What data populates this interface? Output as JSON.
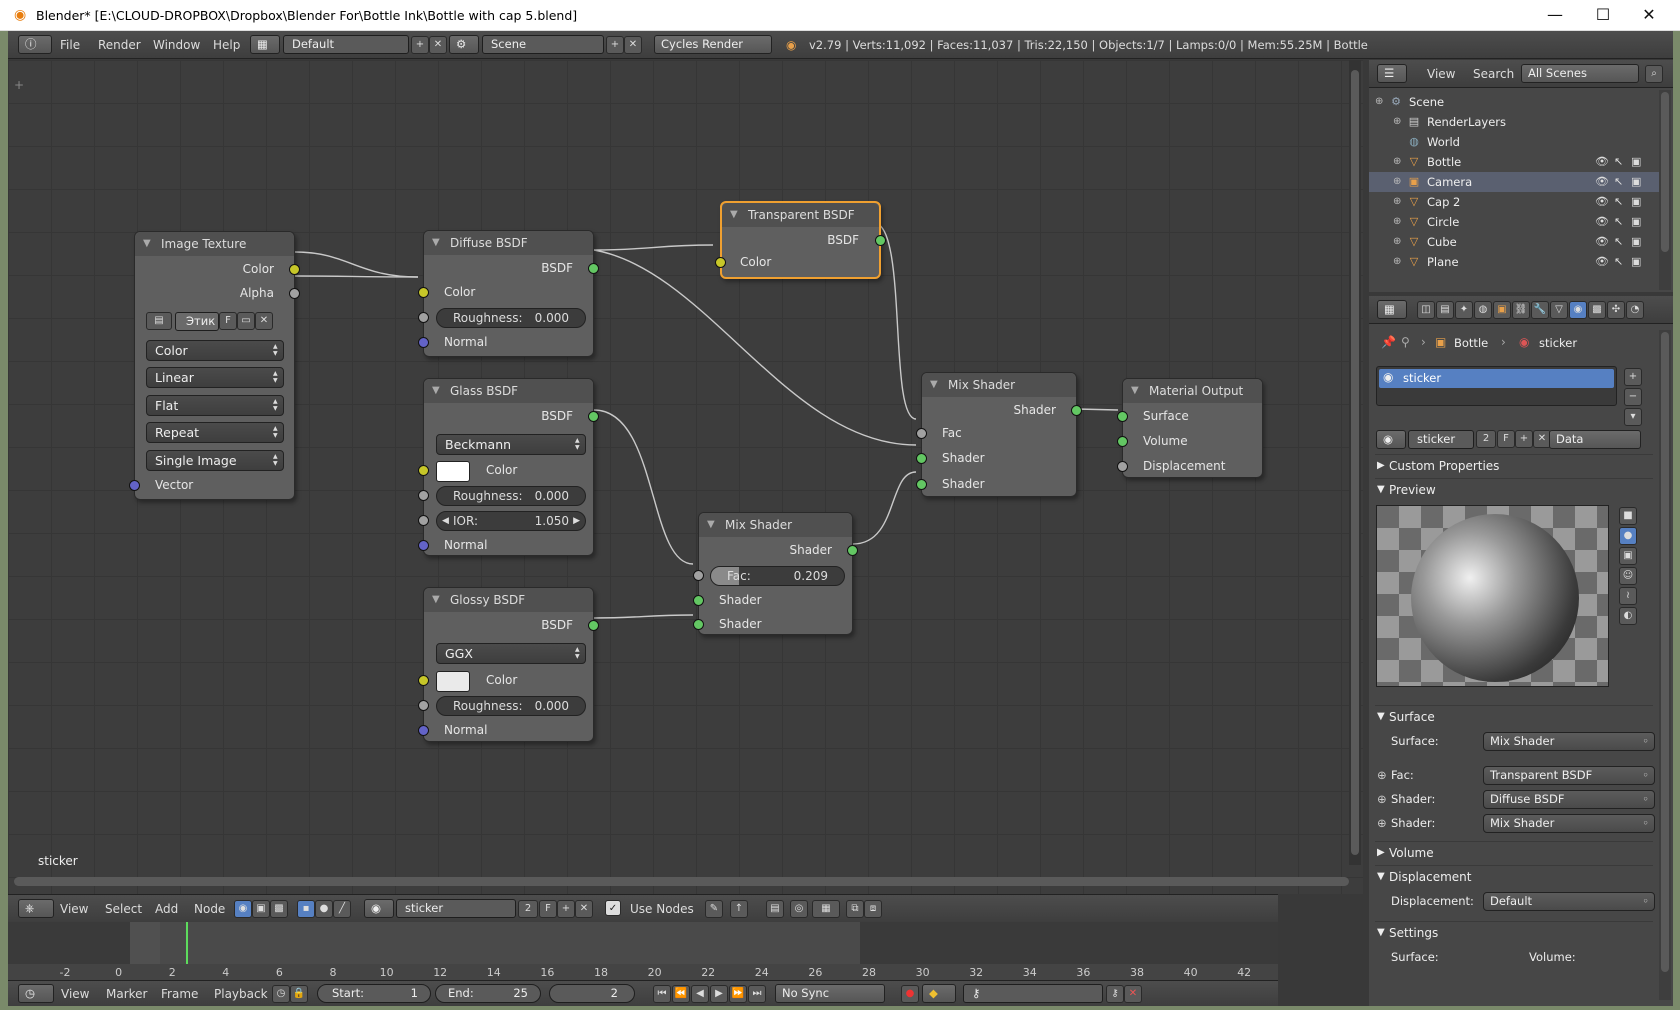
{
  "window": {
    "title": "Blender* [E:\\CLOUD-DROPBOX\\Dropbox\\Blender For\\Bottle Ink\\Bottle with cap 5.blend]",
    "minimize": "—",
    "maximize": "☐",
    "close": "✕"
  },
  "infobar": {
    "menus": [
      "File",
      "Render",
      "Window",
      "Help"
    ],
    "layout": "Default",
    "scene": "Scene",
    "engine": "Cycles Render",
    "stats": "v2.79 | Verts:11,092 | Faces:11,037 | Tris:22,150 | Objects:1/7 | Lamps:0/0 | Mem:55.25M | Bottle"
  },
  "nodes": {
    "image_texture": {
      "title": "Image Texture",
      "out_color": "Color",
      "out_alpha": "Alpha",
      "image_name": "Этик",
      "fake": "F",
      "color_space": "Color",
      "interpolation": "Linear",
      "projection": "Flat",
      "extension": "Repeat",
      "source": "Single Image",
      "in_vector": "Vector"
    },
    "diffuse": {
      "title": "Diffuse BSDF",
      "out": "BSDF",
      "in_color": "Color",
      "roughness_label": "Roughness:",
      "roughness": "0.000",
      "in_normal": "Normal"
    },
    "transparent": {
      "title": "Transparent BSDF",
      "out": "BSDF",
      "in_color": "Color"
    },
    "glass": {
      "title": "Glass BSDF",
      "out": "BSDF",
      "distribution": "Beckmann",
      "in_color": "Color",
      "roughness_label": "Roughness:",
      "roughness": "0.000",
      "ior_label": "IOR:",
      "ior": "1.050",
      "in_normal": "Normal"
    },
    "glossy": {
      "title": "Glossy BSDF",
      "out": "BSDF",
      "distribution": "GGX",
      "in_color": "Color",
      "roughness_label": "Roughness:",
      "roughness": "0.000",
      "in_normal": "Normal"
    },
    "mix2": {
      "title": "Mix Shader",
      "out": "Shader",
      "fac_label": "Fac:",
      "fac": "0.209",
      "fac_fraction": 0.209,
      "in_shader1": "Shader",
      "in_shader2": "Shader"
    },
    "mix1": {
      "title": "Mix Shader",
      "out": "Shader",
      "in_fac": "Fac",
      "in_shader1": "Shader",
      "in_shader2": "Shader"
    },
    "output": {
      "title": "Material Output",
      "in_surface": "Surface",
      "in_volume": "Volume",
      "in_displacement": "Displacement"
    }
  },
  "editor_label": "sticker",
  "node_header": {
    "menus": [
      "View",
      "Select",
      "Add",
      "Node"
    ],
    "material": "sticker",
    "users": "2",
    "fake": "F",
    "use_nodes": "Use Nodes"
  },
  "timeline": {
    "ticks": [
      "-2",
      "0",
      "2",
      "4",
      "6",
      "8",
      "10",
      "12",
      "14",
      "16",
      "18",
      "20",
      "22",
      "24",
      "26",
      "28",
      "30",
      "32",
      "34",
      "36",
      "38",
      "40",
      "42"
    ],
    "menus": [
      "View",
      "Marker",
      "Frame",
      "Playback"
    ],
    "start_label": "Start:",
    "start": "1",
    "end_label": "End:",
    "end": "25",
    "current": "2",
    "sync": "No Sync"
  },
  "outliner": {
    "menus": [
      "View",
      "Search"
    ],
    "filter": "All Scenes",
    "items": [
      {
        "name": "Scene",
        "icon": "scene-icon"
      },
      {
        "name": "RenderLayers",
        "icon": "renderlayers-icon"
      },
      {
        "name": "World",
        "icon": "world-icon"
      },
      {
        "name": "Bottle",
        "icon": "mesh-icon"
      },
      {
        "name": "Camera",
        "icon": "camera-icon"
      },
      {
        "name": "Cap 2",
        "icon": "mesh-icon"
      },
      {
        "name": "Circle",
        "icon": "mesh-icon"
      },
      {
        "name": "Cube",
        "icon": "mesh-icon"
      },
      {
        "name": "Plane",
        "icon": "mesh-icon"
      }
    ]
  },
  "properties": {
    "breadcrumb": {
      "object": "Bottle",
      "material": "sticker"
    },
    "slot": "sticker",
    "material_name": "sticker",
    "users": "2",
    "fake": "F",
    "link": "Data",
    "panels": {
      "custom_properties": "Custom Properties",
      "preview": "Preview",
      "surface": "Surface",
      "volume": "Volume",
      "displacement": "Displacement",
      "settings": "Settings"
    },
    "surface_label": "Surface:",
    "surface_value": "Mix Shader",
    "fac_label": "Fac:",
    "fac_value": "Transparent BSDF",
    "shader1_label": "Shader:",
    "shader1_value": "Diffuse BSDF",
    "shader2_label": "Shader:",
    "shader2_value": "Mix Shader",
    "displacement_label": "Displacement:",
    "displacement_value": "Default",
    "settings_surface": "Surface:",
    "settings_volume": "Volume:"
  },
  "colors": {
    "shader_socket": "#63c763",
    "color_socket": "#c7c729",
    "value_socket": "#a1a1a1",
    "vector_socket": "#6363c7",
    "selected_outline": "#f0a030"
  }
}
